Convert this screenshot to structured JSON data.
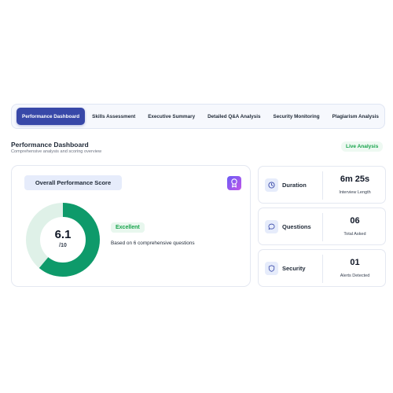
{
  "tabs": [
    {
      "label": "Performance Dashboard",
      "active": true
    },
    {
      "label": "Skills Assessment",
      "active": false
    },
    {
      "label": "Executive Summary",
      "active": false
    },
    {
      "label": "Detailed Q&A Analysis",
      "active": false
    },
    {
      "label": "Security Monitoring",
      "active": false
    },
    {
      "label": "Plagiarism Analysis",
      "active": false
    }
  ],
  "header": {
    "title": "Performance Dashboard",
    "subtitle": "Comprehensive analysis and scoring overview",
    "badge": "Live Analysis"
  },
  "score_card": {
    "title": "Overall Performance Score",
    "score": "6.1",
    "max": "/10",
    "score_fraction": 0.61,
    "rating": "Excellent",
    "description": "Based on 6 comprehensive questions",
    "award_icon": "award-ribbon-icon"
  },
  "stats": [
    {
      "label": "Duration",
      "value": "6m 25s",
      "sub": "Interview Length",
      "icon": "clock-icon"
    },
    {
      "label": "Questions",
      "value": "06",
      "sub": "Total Asked",
      "icon": "chat-bubble-icon"
    },
    {
      "label": "Security",
      "value": "01",
      "sub": "Alerts Detected",
      "icon": "shield-icon"
    }
  ],
  "colors": {
    "accent": "#3848a8",
    "donut_fill": "#0e9a6a",
    "donut_track": "#dff1e8",
    "success": "#16a34a"
  }
}
